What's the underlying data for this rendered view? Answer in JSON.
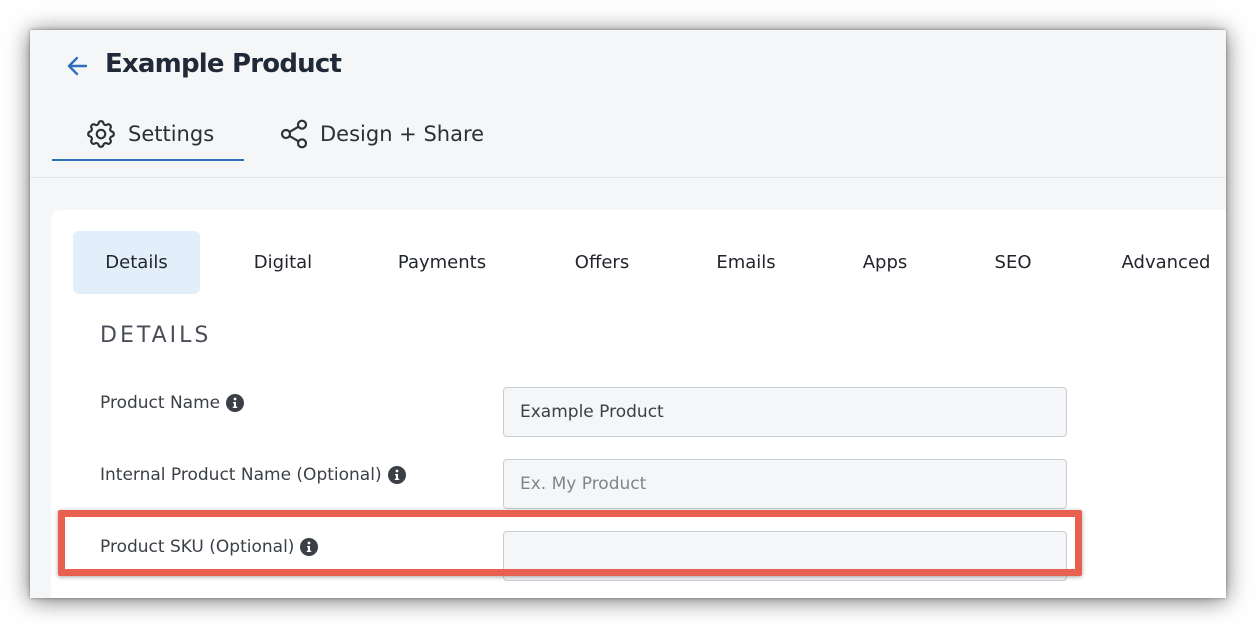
{
  "header": {
    "title": "Example Product",
    "tabs": [
      {
        "label": "Settings",
        "icon": "gear-icon",
        "active": true
      },
      {
        "label": "Design + Share",
        "icon": "share-icon",
        "active": false
      }
    ]
  },
  "subtabs": [
    "Details",
    "Digital",
    "Payments",
    "Offers",
    "Emails",
    "Apps",
    "SEO",
    "Advanced"
  ],
  "details": {
    "heading": "DETAILS",
    "fields": [
      {
        "label": "Product Name",
        "value": "Example Product",
        "placeholder": ""
      },
      {
        "label": "Internal Product Name (Optional)",
        "value": "",
        "placeholder": "Ex. My Product"
      },
      {
        "label": "Product SKU (Optional)",
        "value": "",
        "placeholder": ""
      }
    ]
  },
  "colors": {
    "accent": "#2f6fbf",
    "active_subtab_bg": "#e3eefb",
    "highlight": "#e8604f",
    "header_bg": "#f5f6f8"
  }
}
